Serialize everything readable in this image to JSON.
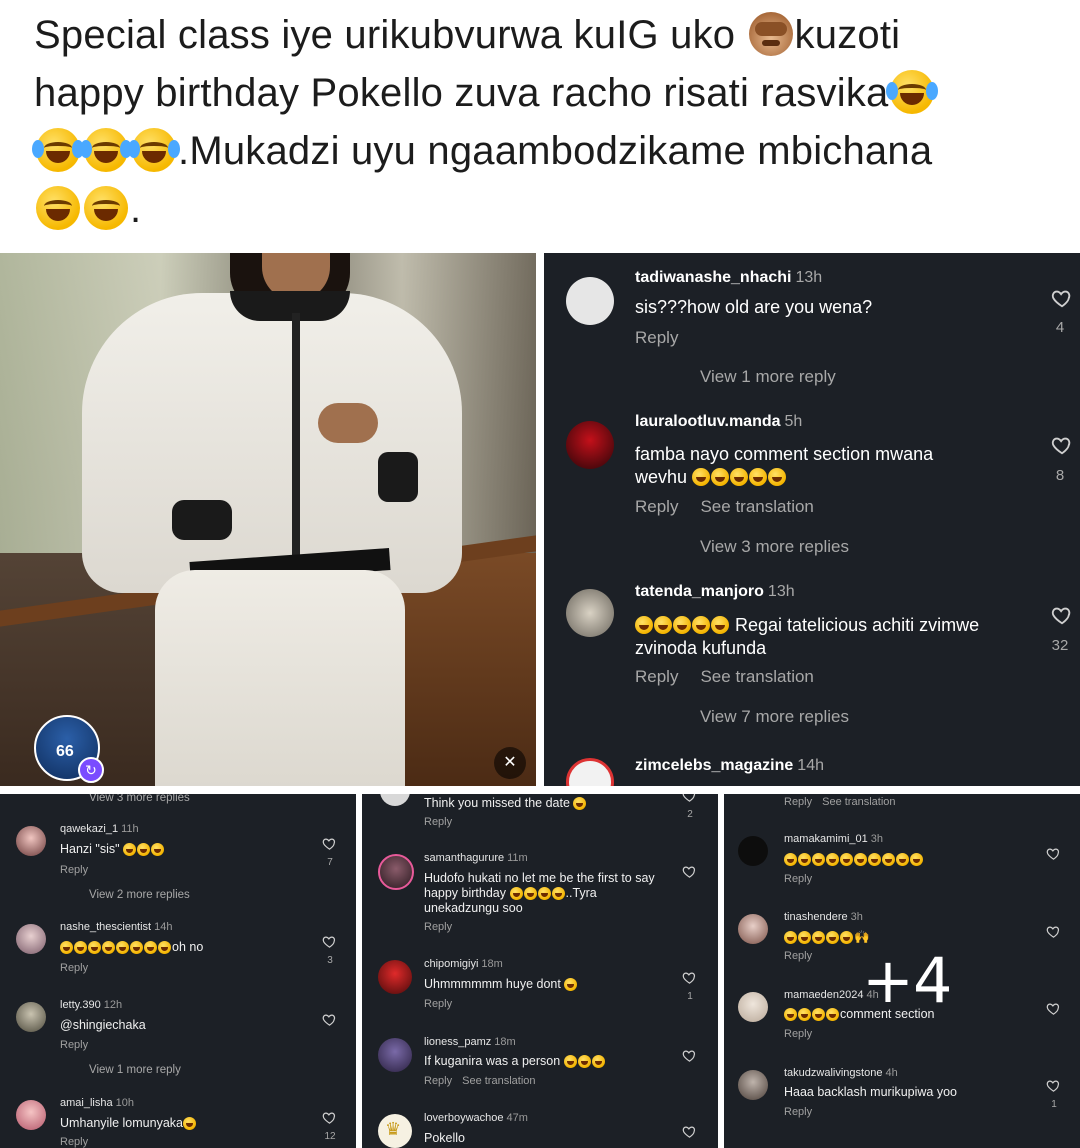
{
  "caption": {
    "line1_a": "Special class iye urikubvurwa kuIG uko ",
    "line1_b": "kuzoti",
    "line2": "happy birthday Pokello zuva racho risati rasvika",
    "line3": ".Mukadzi uyu ngaambodzikame mbichana",
    "line4": "."
  },
  "photo": {
    "badge_number": "66",
    "mute_label": "muted"
  },
  "big_panel": {
    "comments": [
      {
        "user": "tadiwanashe_nhachi",
        "time": "13h",
        "text": "sis???how old are you wena?",
        "reply": "Reply",
        "translate": "",
        "likes": "4",
        "more": "View 1 more reply"
      },
      {
        "user": "lauralootluv.manda",
        "time": "5h",
        "text": "famba nayo comment section mwana wevhu",
        "reply": "Reply",
        "translate": "See translation",
        "likes": "8",
        "more": "View 3 more replies"
      },
      {
        "user": "tatenda_manjoro",
        "time": "13h",
        "text": "Regai tatelicious achiti zvimwe zvinoda kufunda",
        "reply": "Reply",
        "translate": "See translation",
        "likes": "32",
        "more": "View 7 more replies"
      },
      {
        "user": "zimcelebs_magazine",
        "time": "14h"
      }
    ]
  },
  "panel1": {
    "top_more": "View 3 more replies",
    "comments": [
      {
        "user": "qawekazi_1",
        "time": "11h",
        "text": "Hanzi \"sis\"",
        "reply": "Reply",
        "likes": "7",
        "more": "View 2 more replies"
      },
      {
        "user": "nashe_thescientist",
        "time": "14h",
        "text": "oh no",
        "reply": "Reply",
        "likes": "3"
      },
      {
        "user": "letty.390",
        "time": "12h",
        "text": "@shingiechaka",
        "reply": "Reply",
        "more": "View 1 more reply"
      },
      {
        "user": "amai_lisha",
        "time": "10h",
        "text": "Umhanyile lomunyaka",
        "reply": "Reply",
        "likes": "12"
      }
    ]
  },
  "panel2": {
    "comments": [
      {
        "text": "Think you missed the date",
        "reply": "Reply",
        "likes": "2"
      },
      {
        "user": "samanthagurure",
        "time": "11m",
        "text": "Hudofo hukati no let me be the first to say happy birthday",
        "text2": "..Tyra unekadzungu soo",
        "reply": "Reply"
      },
      {
        "user": "chipomigiyi",
        "time": "18m",
        "text": "Uhmmmmmm huye dont",
        "reply": "Reply",
        "likes": "1"
      },
      {
        "user": "lioness_pamz",
        "time": "18m",
        "text": "If kuganira was a person",
        "reply": "Reply",
        "translate": "See translation"
      },
      {
        "user": "loverboywachoe",
        "time": "47m",
        "text": "Pokello"
      }
    ]
  },
  "panel3": {
    "top_reply": "Reply",
    "top_translate": "See translation",
    "comments": [
      {
        "user": "mamakamimi_01",
        "time": "3h",
        "reply": "Reply"
      },
      {
        "user": "tinashendere",
        "time": "3h",
        "reply": "Reply"
      },
      {
        "user": "mamaeden2024",
        "time": "4h",
        "text": "comment section",
        "reply": "Reply"
      },
      {
        "user": "takudzwalivingstone",
        "time": "4h",
        "text": "Haaa backlash murikupiwa yoo",
        "reply": "Reply",
        "likes": "1"
      }
    ]
  },
  "overlay": {
    "more_count": "+4"
  },
  "colors": {
    "panel_bg": "#1c2026",
    "mention": "#8fa6ff"
  }
}
